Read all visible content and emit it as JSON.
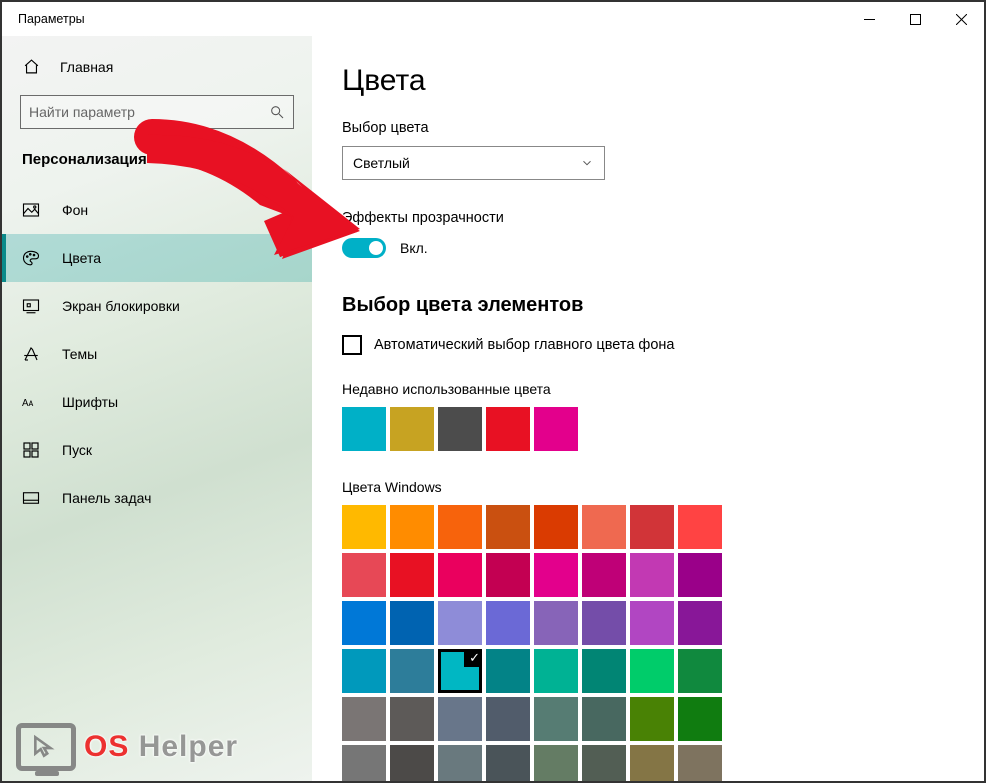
{
  "window": {
    "title": "Параметры"
  },
  "sidebar": {
    "home": "Главная",
    "search_placeholder": "Найти параметр",
    "section": "Персонализация",
    "items": [
      {
        "label": "Фон"
      },
      {
        "label": "Цвета"
      },
      {
        "label": "Экран блокировки"
      },
      {
        "label": "Темы"
      },
      {
        "label": "Шрифты"
      },
      {
        "label": "Пуск"
      },
      {
        "label": "Панель задач"
      }
    ]
  },
  "content": {
    "title": "Цвета",
    "color_choice_label": "Выбор цвета",
    "color_choice_value": "Светлый",
    "transparency_label": "Эффекты прозрачности",
    "transparency_state": "Вкл.",
    "accent_heading": "Выбор цвета элементов",
    "auto_pick_label": "Автоматический выбор главного цвета фона",
    "recent_label": "Недавно использованные цвета",
    "recent_colors": [
      "#00b0c7",
      "#c7a322",
      "#4c4c4c",
      "#e81123",
      "#e3008c"
    ],
    "win_colors_label": "Цвета Windows",
    "win_colors_grid": [
      [
        "#ffb900",
        "#ff8c00",
        "#f7630c",
        "#ca5010",
        "#da3b01",
        "#ef6950",
        "#d13438",
        "#ff4343"
      ],
      [
        "#e74856",
        "#e81123",
        "#ea005e",
        "#c30052",
        "#e3008c",
        "#bf0077",
        "#c239b3",
        "#9a0089"
      ],
      [
        "#0078d7",
        "#0063b1",
        "#8e8cd8",
        "#6b69d6",
        "#8764b8",
        "#744da9",
        "#b146c2",
        "#881798"
      ],
      [
        "#0099bc",
        "#2d7d9a",
        "#00b7c3",
        "#038387",
        "#00b294",
        "#018574",
        "#00cc6a",
        "#10893e"
      ],
      [
        "#7a7574",
        "#5d5a58",
        "#68768a",
        "#515c6b",
        "#567c73",
        "#486860",
        "#498205",
        "#107c10"
      ],
      [
        "#767676",
        "#4c4a48",
        "#69797e",
        "#4a5459",
        "#647c64",
        "#525e54",
        "#847545",
        "#7e735f"
      ]
    ],
    "selected_color_index": {
      "row": 3,
      "col": 2
    }
  },
  "watermark": {
    "os": "OS",
    "helper": "Helper"
  }
}
